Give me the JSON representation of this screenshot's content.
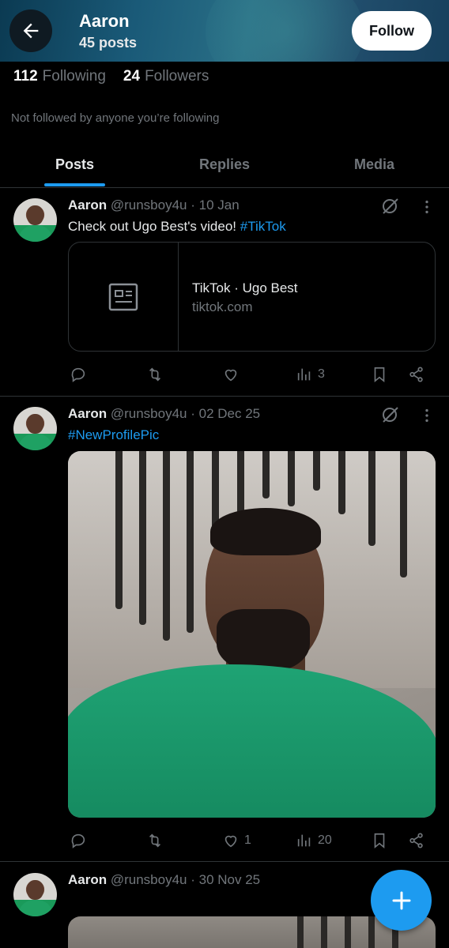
{
  "header": {
    "name": "Aaron",
    "posts_count": "45 posts",
    "follow_label": "Follow"
  },
  "profile": {
    "following_count": "112",
    "following_label": "Following",
    "followers_count": "24",
    "followers_label": "Followers",
    "not_followed_text": "Not followed by anyone you’re following"
  },
  "tabs": [
    {
      "label": "Posts",
      "active": true
    },
    {
      "label": "Replies",
      "active": false
    },
    {
      "label": "Media",
      "active": false
    }
  ],
  "posts": [
    {
      "name": "Aaron",
      "handle": "@runsboy4u",
      "date": "· 10 Jan",
      "text": "Check out Ugo Best's video! ",
      "hashtag": "#TikTok",
      "card": {
        "title": "TikTok · Ugo Best",
        "domain": "tiktok.com",
        "icon": "article-icon"
      },
      "replies": "",
      "reposts": "",
      "likes": "",
      "views": "3"
    },
    {
      "name": "Aaron",
      "handle": "@runsboy4u",
      "date": "· 02 Dec 25",
      "text": "",
      "hashtag": "#NewProfilePic",
      "replies": "",
      "reposts": "",
      "likes": "1",
      "views": "20"
    },
    {
      "name": "Aaron",
      "handle": "@runsboy4u",
      "date": "· 30 Nov 25"
    }
  ],
  "colors": {
    "accent": "#1d9bf0",
    "background": "#000000",
    "secondary_text": "#71767b",
    "border": "#2f3336"
  },
  "icons": {
    "back": "arrow-left-icon",
    "grok": "grok-icon",
    "more": "more-vertical-icon",
    "reply": "reply-icon",
    "repost": "repost-icon",
    "like": "heart-icon",
    "views": "views-icon",
    "bookmark": "bookmark-icon",
    "share": "share-icon",
    "compose": "plus-icon"
  }
}
